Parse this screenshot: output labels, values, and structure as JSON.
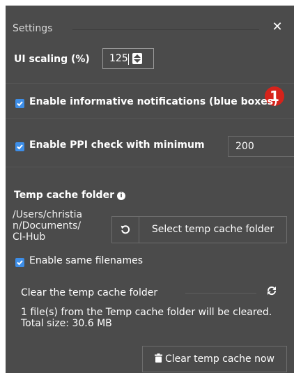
{
  "header": {
    "title": "Settings",
    "close_icon": "close-icon"
  },
  "ui_scaling": {
    "label": "UI scaling (%)",
    "value": "125",
    "stepper_icon": "stepper-icon"
  },
  "badge": {
    "text": "1",
    "color": "#d6231b"
  },
  "notifications": {
    "checked": true,
    "label": "Enable informative notifications (blue boxes)"
  },
  "ppi": {
    "checked": true,
    "label": "Enable PPI check with minimum",
    "value": "200"
  },
  "temp_cache": {
    "title": "Temp cache folder",
    "info_icon": "info-icon",
    "path_lines": [
      "/Users/christia",
      "n/Documents/",
      "CI-Hub"
    ],
    "reset_icon": "reset-icon",
    "select_button": "Select temp cache folder",
    "same_filenames": {
      "checked": true,
      "label": "Enable same filenames"
    }
  },
  "clear": {
    "title": "Clear the temp cache folder",
    "refresh_icon": "refresh-icon",
    "info_text": "1 file(s) from the Temp cache folder will be cleared. Total size: 30.6 MB",
    "button_label": "Clear temp cache now",
    "button_icon": "trash-icon"
  },
  "colors": {
    "panel_bg": "#4b4b4b",
    "accent": "#3d8ee8",
    "badge": "#d6231b",
    "text": "#ffffff"
  }
}
